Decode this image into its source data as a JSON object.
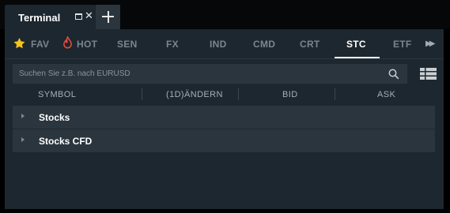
{
  "window": {
    "tab_title": "Terminal",
    "maximize_icon": "maximize-icon",
    "close_glyph": "✕",
    "add_tab_icon": "plus-icon"
  },
  "categories": [
    {
      "label": "FAV",
      "icon": "star-icon",
      "icon_color": "#f5c518",
      "active": false
    },
    {
      "label": "HOT",
      "icon": "flame-icon",
      "icon_color": "#e8493e",
      "active": false
    },
    {
      "label": "SEN",
      "active": false
    },
    {
      "label": "FX",
      "active": false
    },
    {
      "label": "IND",
      "active": false
    },
    {
      "label": "CMD",
      "active": false
    },
    {
      "label": "CRT",
      "active": false
    },
    {
      "label": "STC",
      "active": true
    },
    {
      "label": "ETF",
      "active": false
    }
  ],
  "more_glyph": "▶▶",
  "search": {
    "placeholder": "Suchen Sie z.B. nach EURUSD",
    "value": ""
  },
  "columns": [
    "SYMBOL",
    "(1D)ÄNDERN",
    "BID",
    "ASK"
  ],
  "groups": [
    {
      "label": "Stocks",
      "expanded": false
    },
    {
      "label": "Stocks CFD",
      "expanded": false
    }
  ],
  "colors": {
    "background": "#000000",
    "panel": "#1d272f",
    "row": "#2a353e",
    "active_tab_text": "#ffffff",
    "inactive_tab_text": "#7b858d"
  }
}
